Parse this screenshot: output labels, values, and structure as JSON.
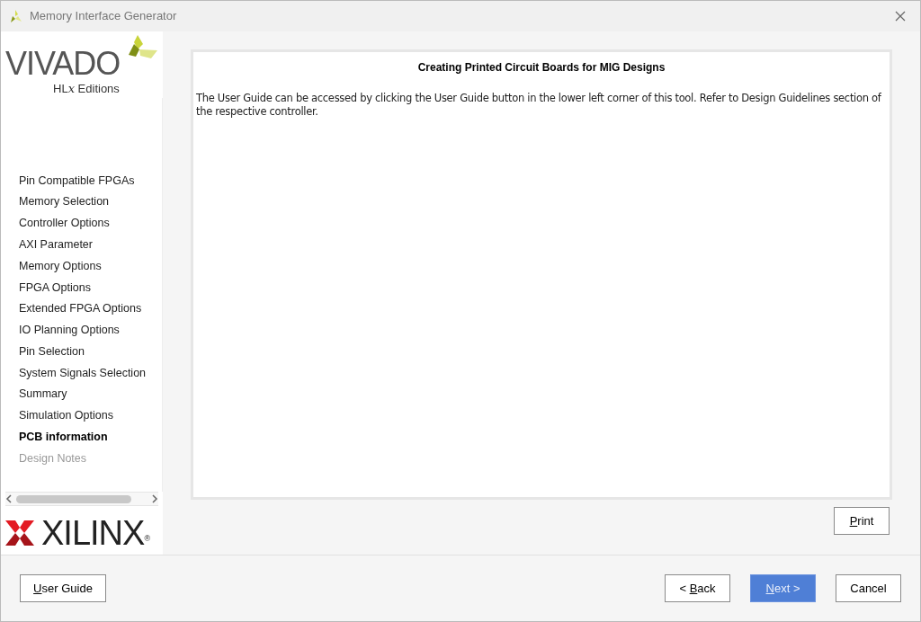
{
  "window": {
    "title": "Memory Interface Generator"
  },
  "logo": {
    "product": "VIVADO",
    "edition_prefix": "HL",
    "edition_x": "x",
    "edition_suffix": "Editions",
    "vendor": "XILINX",
    "registered": "®"
  },
  "sidebar": {
    "items": [
      {
        "label": "Pin Compatible FPGAs",
        "selected": false,
        "disabled": false
      },
      {
        "label": "Memory Selection",
        "selected": false,
        "disabled": false
      },
      {
        "label": "Controller Options",
        "selected": false,
        "disabled": false
      },
      {
        "label": "AXI Parameter",
        "selected": false,
        "disabled": false
      },
      {
        "label": "Memory Options",
        "selected": false,
        "disabled": false
      },
      {
        "label": "FPGA Options",
        "selected": false,
        "disabled": false
      },
      {
        "label": "Extended FPGA Options",
        "selected": false,
        "disabled": false
      },
      {
        "label": "IO Planning Options",
        "selected": false,
        "disabled": false
      },
      {
        "label": "Pin Selection",
        "selected": false,
        "disabled": false
      },
      {
        "label": "System Signals Selection",
        "selected": false,
        "disabled": false
      },
      {
        "label": "Summary",
        "selected": false,
        "disabled": false
      },
      {
        "label": "Simulation Options",
        "selected": false,
        "disabled": false
      },
      {
        "label": "PCB information",
        "selected": true,
        "disabled": false
      },
      {
        "label": "Design Notes",
        "selected": false,
        "disabled": true
      }
    ]
  },
  "content": {
    "heading": "Creating Printed Circuit Boards for MIG Designs",
    "body": "The User Guide can be accessed by clicking the User Guide button in the lower left corner of this tool. Refer to Design Guidelines section of the respective controller."
  },
  "print_button": {
    "label_parts": [
      {
        "text": "P",
        "underlined": true
      },
      {
        "text": "rint",
        "underlined": false
      }
    ]
  },
  "footer": {
    "buttons": [
      {
        "kind": "plain",
        "label_parts": [
          {
            "text": "U",
            "underlined": true
          },
          {
            "text": "ser Guide",
            "underlined": false
          }
        ]
      },
      {
        "kind": "plain",
        "label_parts": [
          {
            "text": "< ",
            "underlined": false
          },
          {
            "text": "B",
            "underlined": true
          },
          {
            "text": "ack",
            "underlined": false
          }
        ]
      },
      {
        "kind": "primary",
        "label_parts": [
          {
            "text": "N",
            "underlined": true
          },
          {
            "text": "ext >",
            "underlined": false
          }
        ]
      },
      {
        "kind": "plain",
        "label_parts": [
          {
            "text": "Cancel",
            "underlined": false
          }
        ]
      }
    ]
  }
}
